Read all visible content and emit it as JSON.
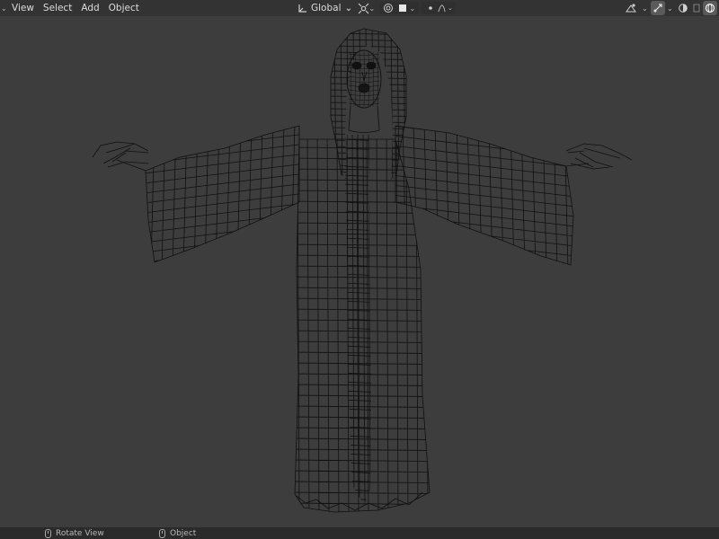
{
  "header": {
    "menu": [
      "View",
      "Select",
      "Add",
      "Object"
    ],
    "orientation_label": "Global",
    "icons": {
      "editor_type": "chevron-down-icon",
      "orientation": "transform-orientation-icon",
      "pivot": "pivot-point-icon",
      "snap": "snap-icon",
      "snap_increment": "snap-increment-icon",
      "proportional": "proportional-editing-icon",
      "falloff": "falloff-curve-icon",
      "visibility": "object-visibility-icon",
      "gizmo": "gizmo-icon",
      "overlays": "overlays-icon",
      "xray": "xray-toggle-icon",
      "shading": "shading-wireframe-icon"
    }
  },
  "viewport": {
    "background": "#3d3d3d",
    "wire_color": "#101010",
    "shading_mode": "wireframe"
  },
  "statusbar": {
    "left_label": "Rotate View",
    "middle_label": "Object"
  },
  "colors": {
    "header_bg": "#2b2b2b",
    "status_bg": "#2a2a2a",
    "text": "#d8d8d8"
  }
}
